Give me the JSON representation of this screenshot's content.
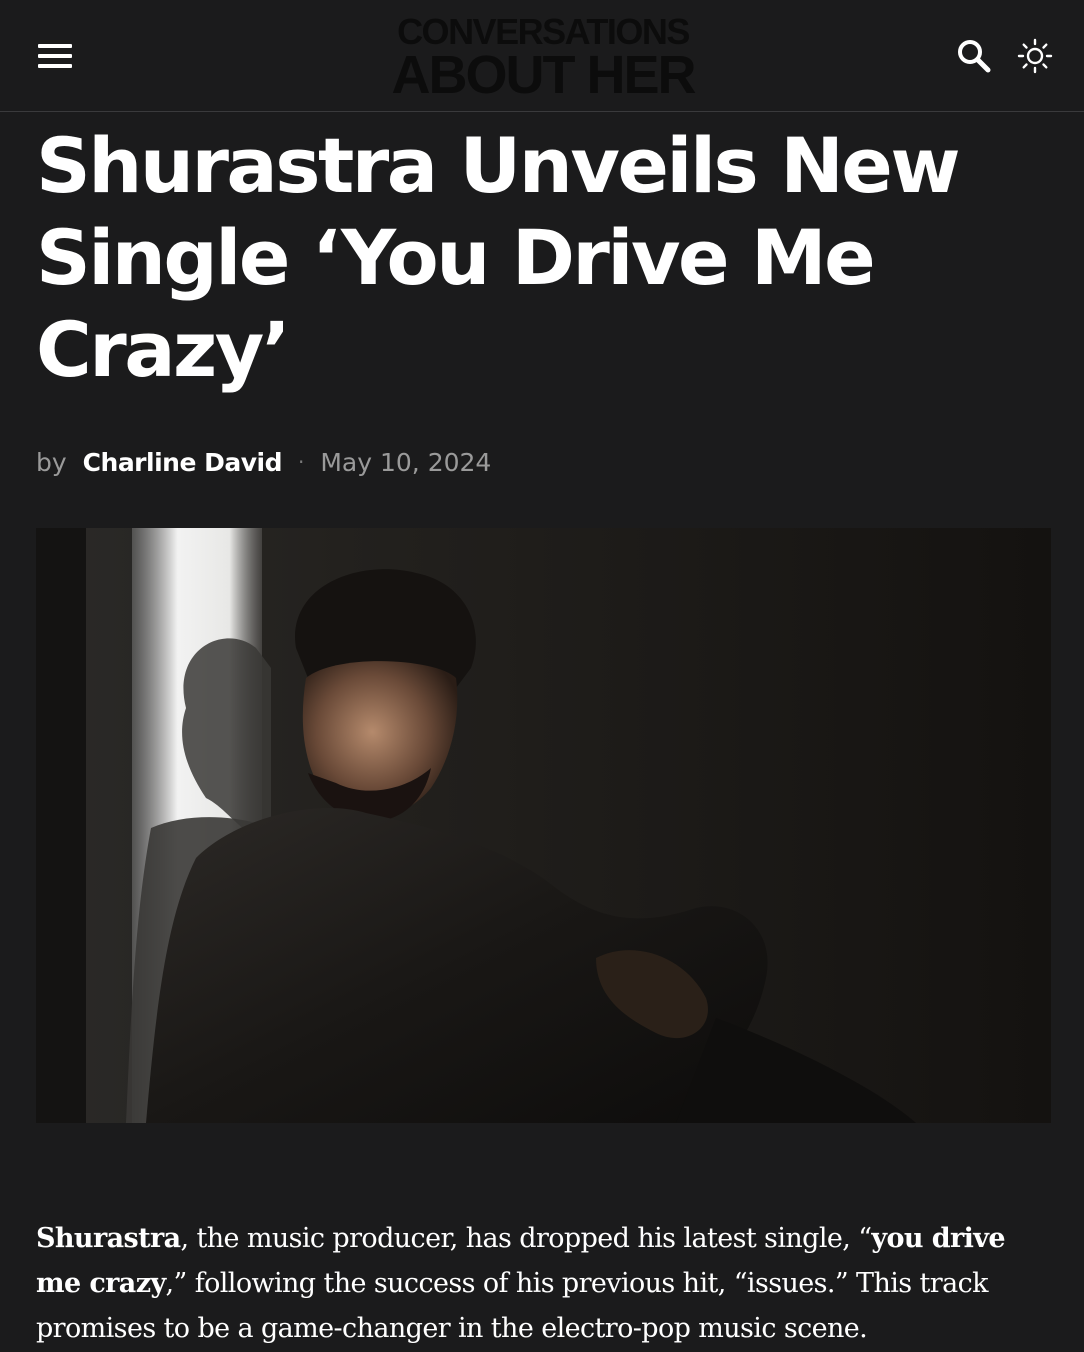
{
  "header": {
    "logo_line1": "CONVERSATIONS",
    "logo_line2": "ABOUT HER",
    "menu_icon": "hamburger-menu-icon",
    "search_icon": "search-icon",
    "theme_icon": "sun-icon"
  },
  "article": {
    "title": "Shurastra Unveils New Single ‘You Drive Me Crazy’",
    "byline_prefix": "by",
    "author": "Charline David",
    "separator": "·",
    "date": "May 10, 2024",
    "image_alt": "Shurastra seated in a dark room with light falling across him",
    "intro": {
      "artist": "Shurastra",
      "text1": ", the music producer, has dropped his latest single, “",
      "single": "you drive me crazy",
      "text2": ",” following the success of his previous hit, “issues.” This track promises to be a game-changer in the electro-pop music scene."
    }
  },
  "colors": {
    "background": "#1b1b1c",
    "text": "#ffffff",
    "muted": "#9a9a9a",
    "logo": "#0c0c0c"
  }
}
